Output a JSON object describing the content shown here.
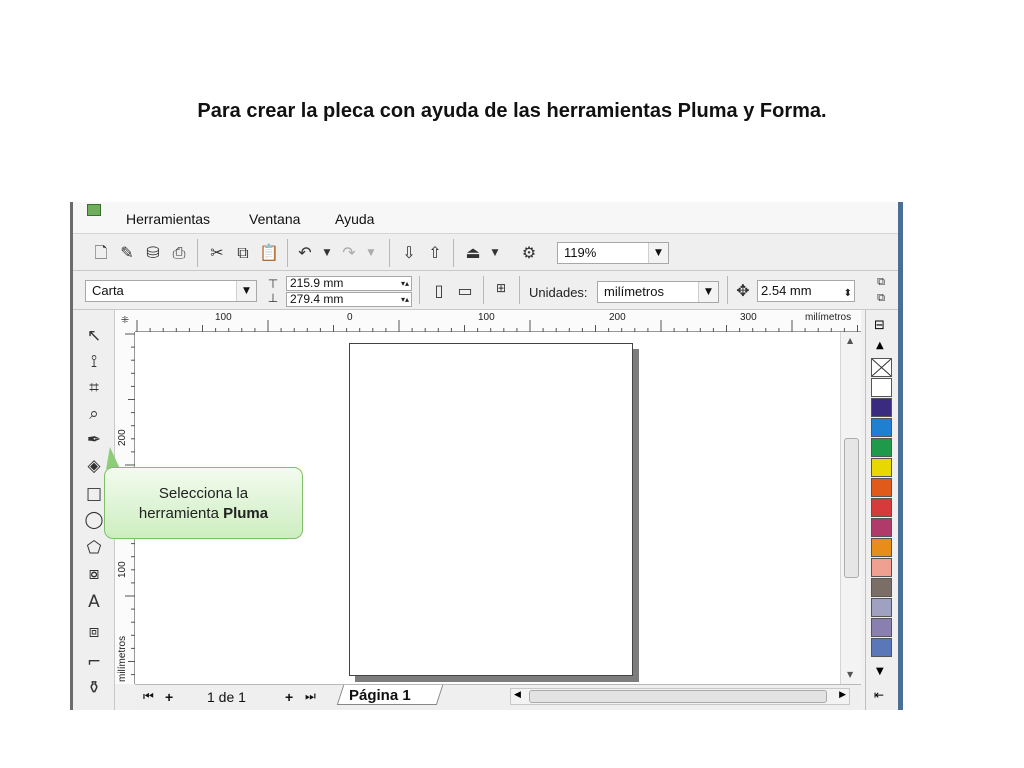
{
  "slide": {
    "title": "Para crear la pleca con ayuda de las herramientas Pluma y Forma."
  },
  "menubar": {
    "items": [
      "Herramientas",
      "Ventana",
      "Ayuda"
    ]
  },
  "toolbar1": {
    "zoom": "119%"
  },
  "toolbar2": {
    "paper": "Carta",
    "width": "215.9 mm",
    "height": "279.4 mm",
    "units_label": "Unidades:",
    "units_value": "milímetros",
    "nudge": "2.54 mm"
  },
  "ruler": {
    "h_labels": [
      "100",
      "0",
      "100",
      "200",
      "300"
    ],
    "unit": "milímetros",
    "v_labels": [
      "200",
      "100"
    ]
  },
  "tools": [
    "pick-tool-icon",
    "shape-tool-icon",
    "crop-tool-icon",
    "zoom-tool-icon",
    "freehand-tool-icon",
    "smart-fill-icon",
    "rectangle-tool-icon",
    "ellipse-tool-icon",
    "polygon-tool-icon",
    "basic-shapes-icon",
    "text-tool-icon",
    "blend-tool-icon",
    "eyedropper-icon",
    "fill-tool-icon"
  ],
  "palette": {
    "colors": [
      "#3a2a80",
      "#1f7fd0",
      "#1f9a4a",
      "#e8d800",
      "#e05a1a",
      "#d63a3a",
      "#b03a6a",
      "#e88c1a",
      "#f0a090",
      "#7a6e66",
      "#a0a0c0",
      "#8a80b0",
      "#5a78b8"
    ]
  },
  "pagebar": {
    "counter": "1 de 1",
    "page_tab": "Página 1"
  },
  "callout": {
    "line1": "Selecciona la",
    "line2_prefix": "herramienta ",
    "line2_bold": "Pluma"
  }
}
